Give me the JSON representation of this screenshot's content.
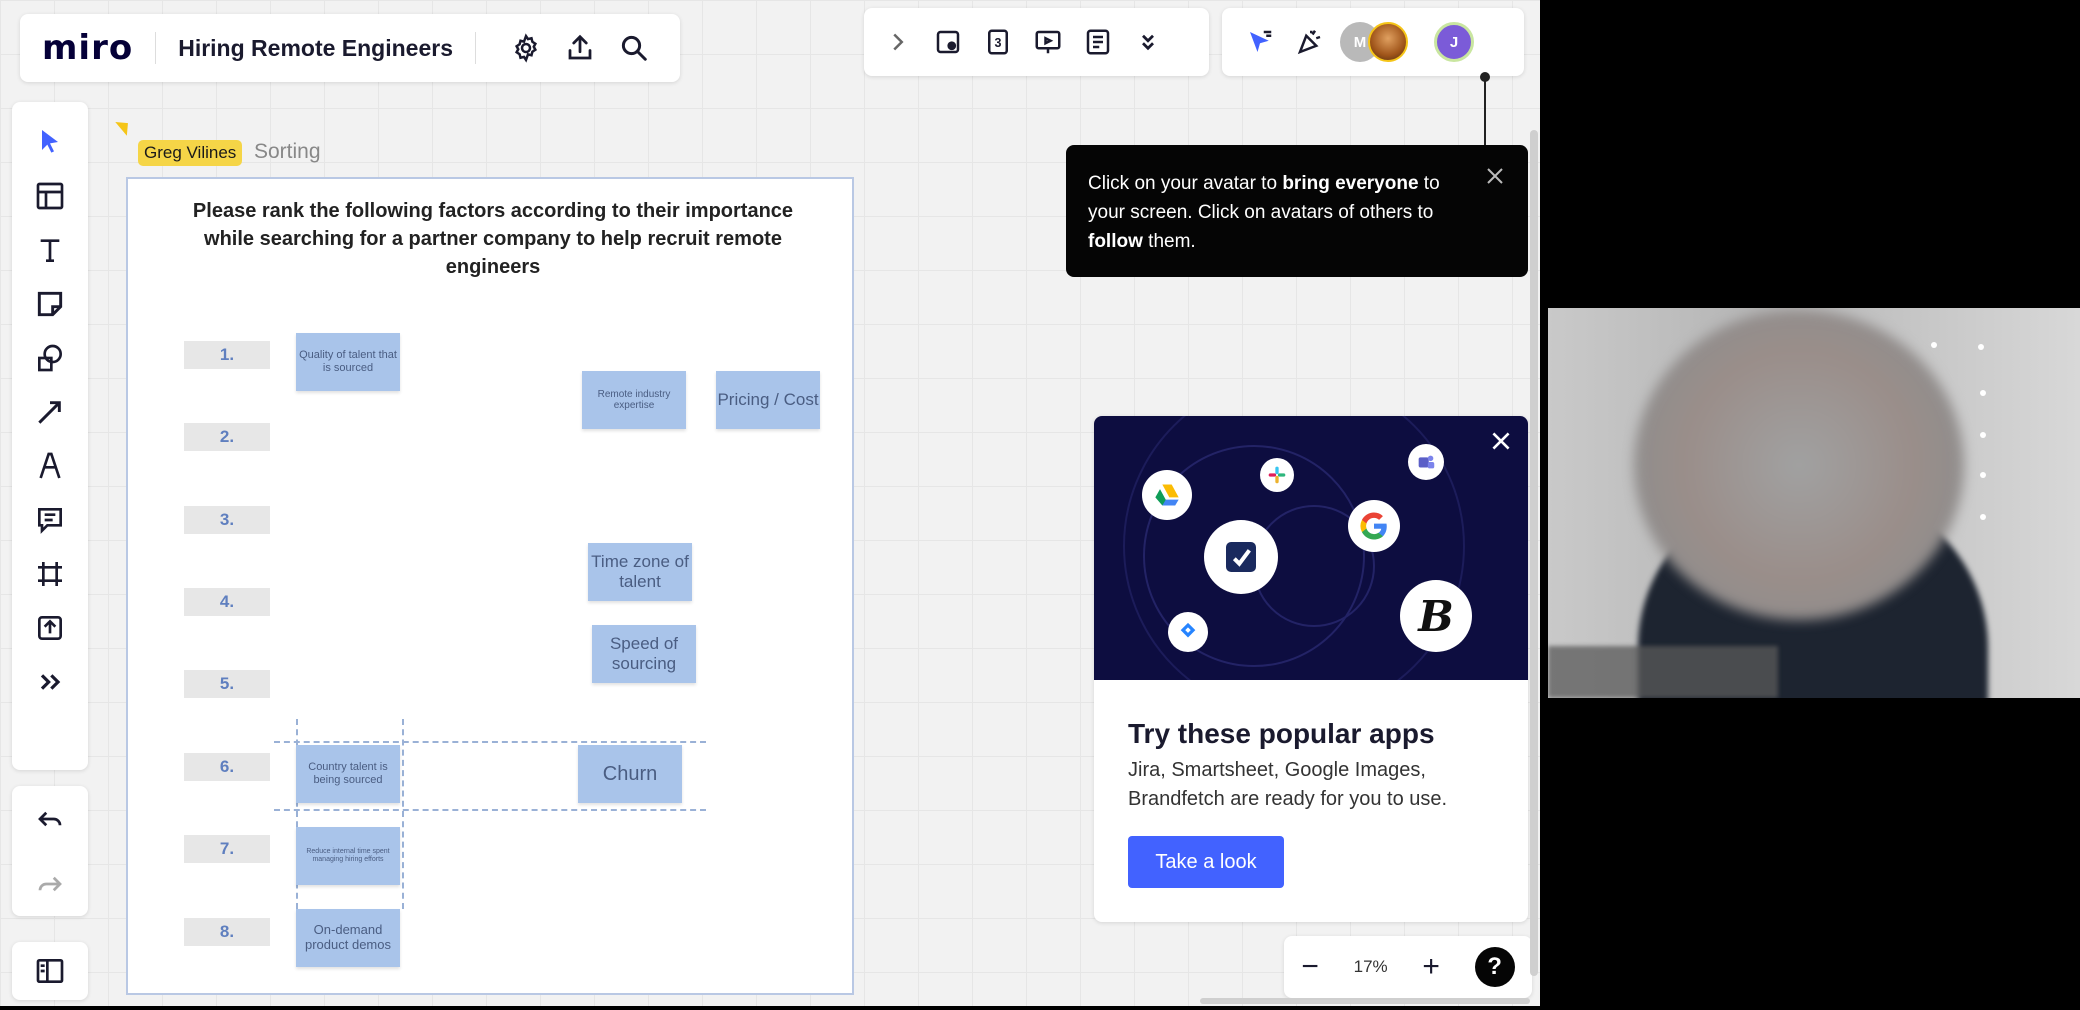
{
  "header": {
    "logo": "miro",
    "board_title": "Hiring Remote Engineers",
    "icons": [
      "settings-icon",
      "export-icon",
      "search-icon"
    ]
  },
  "collab_toolbar": {
    "icons": [
      "chevron-right-icon",
      "sticky-add-icon",
      "count-icon",
      "presentation-icon",
      "notes-icon",
      "double-chevron-down-icon"
    ],
    "count_label": "3"
  },
  "presence": {
    "icons": [
      "cursor-filter-icon",
      "celebrate-icon"
    ],
    "avatars": [
      {
        "initial": "M",
        "color": "#b9b9b9"
      },
      {
        "initial": "",
        "color": "#c77a2a"
      },
      {
        "initial": "J",
        "color": "#7b5bd8"
      }
    ]
  },
  "left_toolbar": {
    "tools": [
      "select-icon",
      "templates-icon",
      "text-icon",
      "sticky-note-icon",
      "shapes-icon",
      "connector-icon",
      "pen-icon",
      "comment-icon",
      "frame-icon",
      "upload-icon",
      "more-icon"
    ],
    "undo_icon": "undo-icon",
    "redo_icon": "redo-icon",
    "panel_icon": "side-panel-icon"
  },
  "cursor": {
    "name": "Greg Vilines",
    "color": "#f5d547"
  },
  "frame": {
    "label": "Sorting",
    "question": "Please rank the following factors according to their importance while searching for a partner company to help recruit remote engineers",
    "ranks": [
      "1.",
      "2.",
      "3.",
      "4.",
      "5.",
      "6.",
      "7.",
      "8."
    ],
    "stickies": [
      {
        "text": "Quality of talent that is sourced"
      },
      {
        "text": "Remote industry expertise"
      },
      {
        "text": "Pricing / Cost"
      },
      {
        "text": "Time zone of talent"
      },
      {
        "text": "Speed of sourcing"
      },
      {
        "text": "Country talent is being sourced"
      },
      {
        "text": "Churn"
      },
      {
        "text": "Reduce internal time spent managing hiring efforts"
      },
      {
        "text": "On-demand product demos"
      }
    ]
  },
  "tooltip": {
    "text_1": "Click on your avatar to ",
    "bold_1": "bring everyone",
    "text_2": " to your screen. Click on avatars of others to ",
    "bold_2": "follow",
    "text_3": " them."
  },
  "app_card": {
    "title": "Try these popular apps",
    "description": "Jira, Smartsheet, Google Images, Brandfetch are ready for you to use.",
    "button": "Take a look",
    "apps": [
      "google-drive-icon",
      "slack-icon",
      "teams-icon",
      "miro-app-icon",
      "google-icon",
      "brandfetch-icon",
      "jira-icon"
    ],
    "brandfetch_letter": "B"
  },
  "zoom": {
    "level": "17%",
    "minus": "−",
    "plus": "+",
    "help": "?"
  },
  "colors": {
    "accent": "#4262ff",
    "sticky": "#a9c4ea",
    "tooltip_bg": "#050505",
    "hero_bg": "#0d0d40"
  }
}
